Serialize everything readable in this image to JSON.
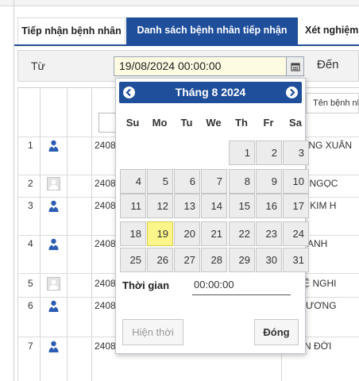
{
  "tabs": [
    {
      "label": "Tiếp nhận bệnh nhân"
    },
    {
      "label": "Danh sách bệnh nhân tiếp nhận"
    },
    {
      "label": "Xét nghiệm"
    }
  ],
  "filter": {
    "from_label": "Từ",
    "from_value": "19/08/2024 00:00:00",
    "to_label": "Đến",
    "calendar_icon": "calendar-icon"
  },
  "table": {
    "name_header": "Tên bệnh nhân",
    "rows": [
      {
        "no": "1",
        "id": "2408",
        "name": "HỊ HỒNG XUÂN",
        "icon": "person-icon"
      },
      {
        "no": "2",
        "id": "2408",
        "name": "N THỊ NGỌC",
        "icon": "no-photo-icon"
      },
      {
        "no": "3",
        "id": "2408",
        "name": "G THỊ KIM H",
        "icon": "person-icon"
      },
      {
        "no": "4",
        "id": "2408",
        "name": "THỊ OANH",
        "icon": "person-icon"
      },
      {
        "no": "5",
        "id": "2408",
        "name": "Ễ TUỆ NGHI",
        "icon": "no-photo-icon"
      },
      {
        "no": "6",
        "id": "2408",
        "name": "M PHƯƠNG",
        "icon": "person-icon"
      },
      {
        "no": "7",
        "id": "2408",
        "name": "N VĂN ĐỜI",
        "icon": "person-icon"
      }
    ]
  },
  "calendar": {
    "title": "Tháng 8 2024",
    "weekdays": [
      "Su",
      "Mo",
      "Tu",
      "We",
      "Th",
      "Fr",
      "Sa"
    ],
    "days": [
      "1",
      "2",
      "3",
      "4",
      "5",
      "6",
      "7",
      "8",
      "9",
      "10",
      "11",
      "12",
      "13",
      "14",
      "15",
      "16",
      "17",
      "18",
      "19",
      "20",
      "21",
      "22",
      "23",
      "24",
      "25",
      "26",
      "27",
      "28",
      "29",
      "30",
      "31"
    ],
    "selected_day": "19",
    "first_weekday_index": 4,
    "time_label": "Thời gian",
    "time_value": "00:00:00",
    "now_button": "Hiện thời",
    "close_button": "Đóng",
    "colors": {
      "header": "#1f4e9a",
      "today": "#fbf58a",
      "input_bg": "#fdfbe1"
    }
  }
}
